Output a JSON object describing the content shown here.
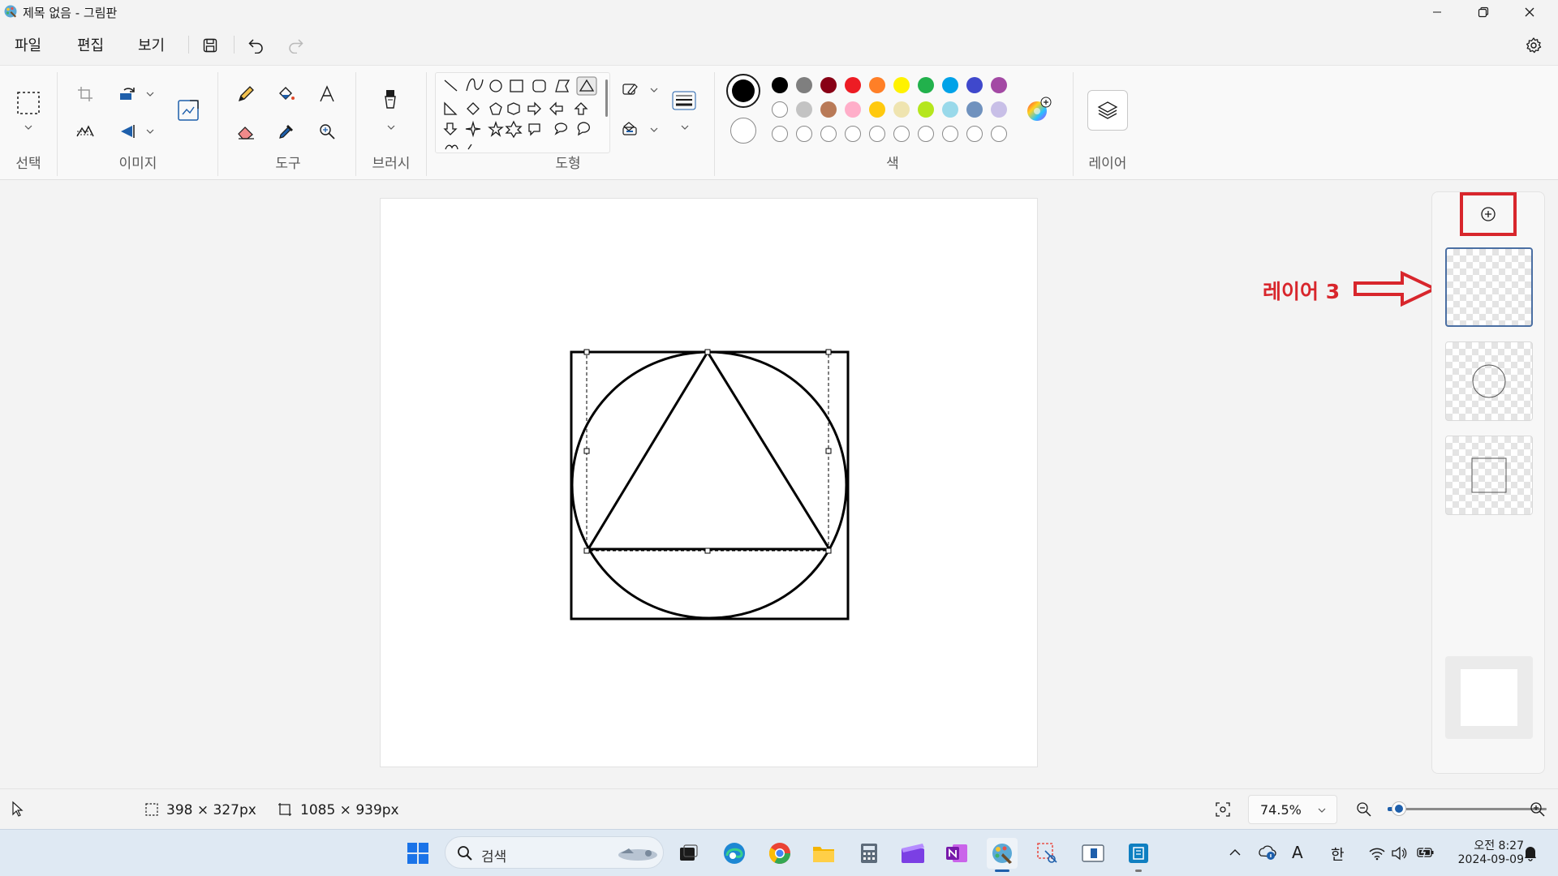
{
  "window": {
    "title": "제목 없음 - 그림판"
  },
  "menu": {
    "items": [
      "파일",
      "편집",
      "보기"
    ]
  },
  "ribbon": {
    "groups": {
      "select": "선택",
      "image": "이미지",
      "tools": "도구",
      "brush": "브러시",
      "shapes": "도형",
      "colors": "색",
      "layers": "레이어"
    },
    "current_color": "#000000",
    "secondary_color": "#ffffff",
    "palette_row1": [
      "#000000",
      "#7f7f7f",
      "#880015",
      "#ed1c24",
      "#ff7f27",
      "#fff200",
      "#22b14c",
      "#00a2e8",
      "#3f48cc",
      "#a349a4"
    ],
    "palette_row2": [
      "#ffffff",
      "#c3c3c3",
      "#b97a57",
      "#ffaec9",
      "#ffc90e",
      "#efe4b0",
      "#b5e61d",
      "#99d9ea",
      "#7092be",
      "#c8bfe7"
    ]
  },
  "annotation": {
    "label": "레이어 3",
    "color": "#d8262c"
  },
  "layers": {
    "count_shown": 3,
    "active_index": 0,
    "items": [
      "layer-3-empty",
      "layer-2-circle",
      "layer-1-square"
    ]
  },
  "status": {
    "selection_size": "398 × 327px",
    "canvas_size": "1085 × 939px",
    "zoom": "74.5%",
    "zoom_slider_fraction": 0.07
  },
  "taskbar": {
    "search_placeholder": "검색",
    "ime_mode": "한",
    "font_glyph": "A",
    "time": "오전 8:27",
    "date": "2024-09-09"
  }
}
